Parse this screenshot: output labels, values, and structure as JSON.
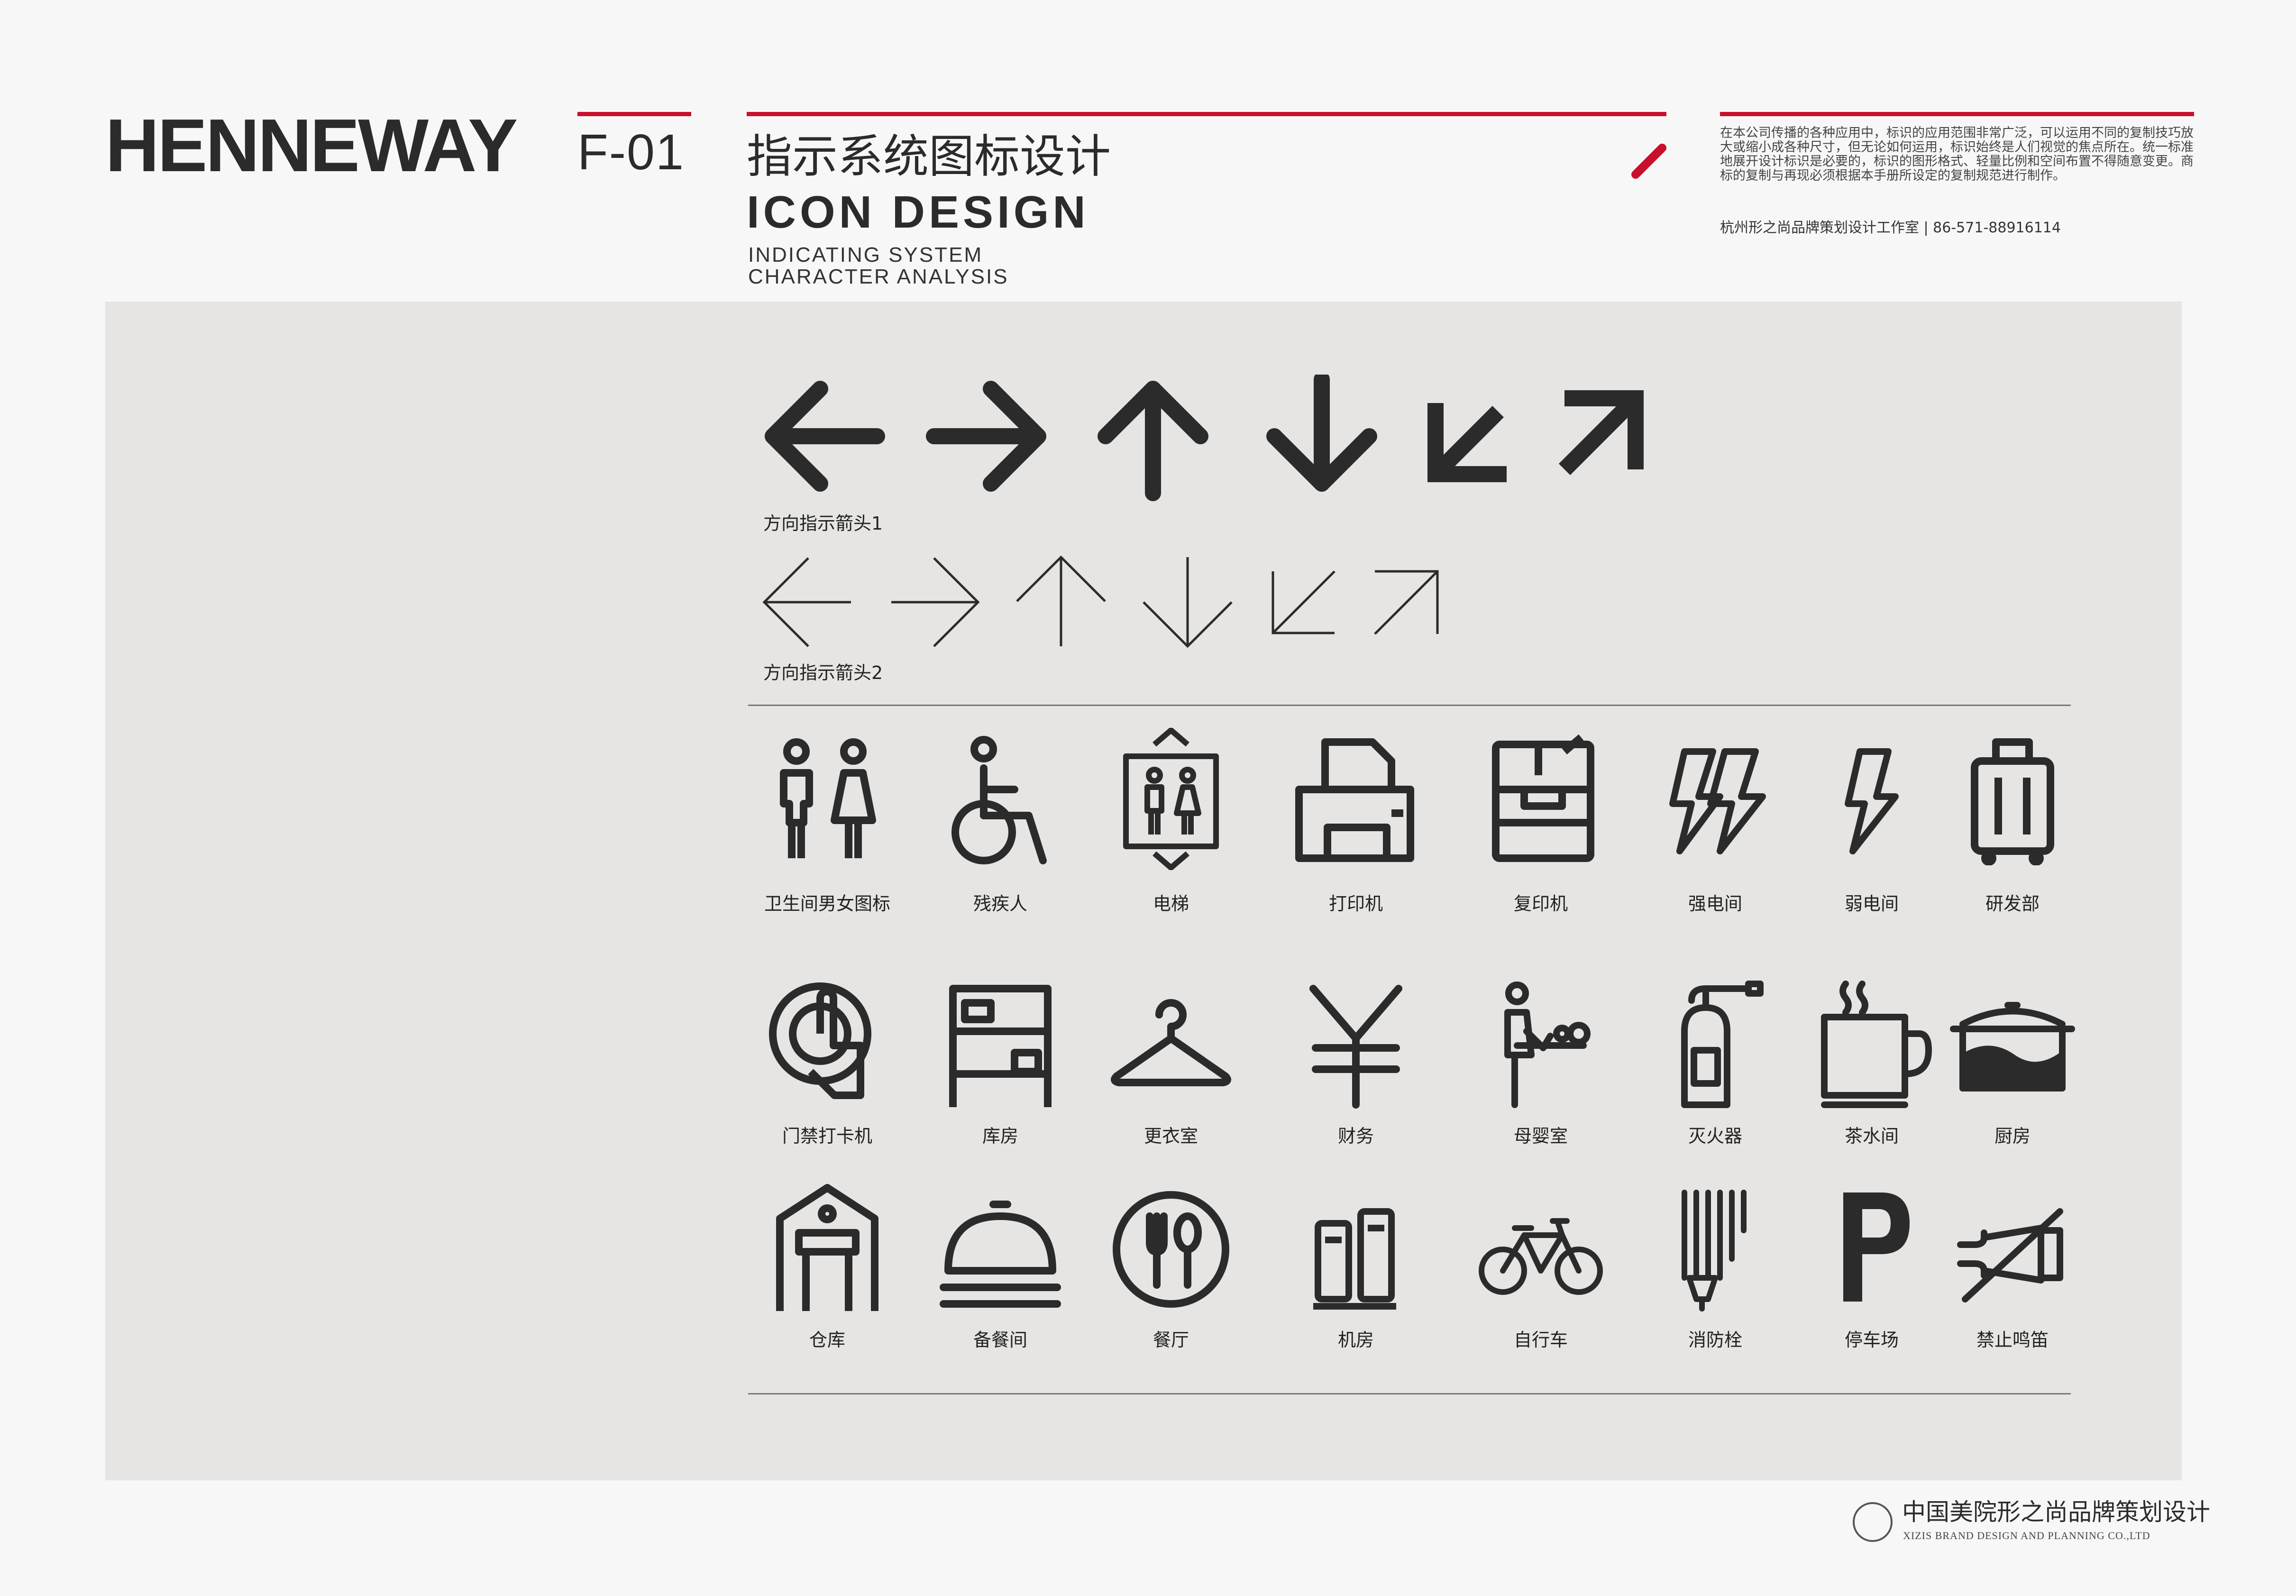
{
  "header": {
    "brand": "HENNEWAY",
    "code": "F-01",
    "title_cn": "指示系统图标设计",
    "title_en": "ICON DESIGN",
    "subtitle_line1": "INDICATING SYSTEM",
    "subtitle_line2": "CHARACTER ANALYSIS",
    "note": "在本公司传播的各种应用中，标识的应用范围非常广泛，可以运用不同的复制技巧放大或缩小成各种尺寸，但无论如何运用，标识始终是人们视觉的焦点所在。统一标准地展开设计标识是必要的，标识的图形格式、轻量比例和空间布置不得随意变更。商标的复制与再现必须根据本手册所设定的复制规范进行制作。",
    "contact": "杭州形之尚品牌策划设计工作室 | 86-571-88916114",
    "accent_color": "#c8102e"
  },
  "arrows": {
    "caption1": "方向指示箭头1",
    "caption2": "方向指示箭头2"
  },
  "icons": {
    "row1": [
      {
        "label": "卫生间男女图标",
        "icon": "restroom-icon"
      },
      {
        "label": "残疾人",
        "icon": "wheelchair-icon"
      },
      {
        "label": "电梯",
        "icon": "elevator-icon"
      },
      {
        "label": "打印机",
        "icon": "printer-icon"
      },
      {
        "label": "复印机",
        "icon": "copier-icon"
      },
      {
        "label": "强电间",
        "icon": "strong-power-icon"
      },
      {
        "label": "弱电间",
        "icon": "weak-power-icon"
      },
      {
        "label": "研发部",
        "icon": "suitcase-icon"
      }
    ],
    "row2": [
      {
        "label": "门禁打卡机",
        "icon": "access-card-icon"
      },
      {
        "label": "库房",
        "icon": "storeroom-icon"
      },
      {
        "label": "更衣室",
        "icon": "hanger-icon"
      },
      {
        "label": "财务",
        "icon": "yen-icon"
      },
      {
        "label": "母婴室",
        "icon": "baby-room-icon"
      },
      {
        "label": "灭火器",
        "icon": "extinguisher-icon"
      },
      {
        "label": "茶水间",
        "icon": "tea-cup-icon"
      },
      {
        "label": "厨房",
        "icon": "pot-icon"
      }
    ],
    "row3": [
      {
        "label": "仓库",
        "icon": "warehouse-icon"
      },
      {
        "label": "备餐间",
        "icon": "cloche-icon"
      },
      {
        "label": "餐厅",
        "icon": "restaurant-icon"
      },
      {
        "label": "机房",
        "icon": "server-icon"
      },
      {
        "label": "自行车",
        "icon": "bicycle-icon"
      },
      {
        "label": "消防栓",
        "icon": "hydrant-icon"
      },
      {
        "label": "停车场",
        "icon": "parking-icon"
      },
      {
        "label": "禁止鸣笛",
        "icon": "no-horn-icon"
      }
    ]
  },
  "footer": {
    "company_cn": "中国美院形之尚品牌策划设计",
    "company_en": "XIZIS BRAND DESIGN AND PLANNING CO.,LTD"
  }
}
